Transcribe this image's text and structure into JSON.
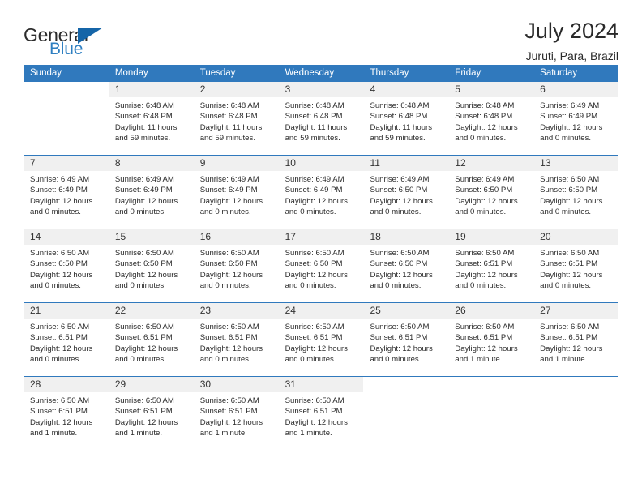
{
  "brand": {
    "name_part1": "General",
    "name_part2": "Blue",
    "triangle_icon": "triangle-icon",
    "accent_color": "#2e7fc1",
    "header_bar_color": "#3079bd"
  },
  "header": {
    "title": "July 2024",
    "subtitle": "Juruti, Para, Brazil"
  },
  "calendar": {
    "weekday_headers": [
      "Sunday",
      "Monday",
      "Tuesday",
      "Wednesday",
      "Thursday",
      "Friday",
      "Saturday"
    ],
    "weeks": [
      [
        {
          "day": "",
          "sunrise": "",
          "sunset": "",
          "daylight1": "",
          "daylight2": ""
        },
        {
          "day": "1",
          "sunrise": "Sunrise: 6:48 AM",
          "sunset": "Sunset: 6:48 PM",
          "daylight1": "Daylight: 11 hours",
          "daylight2": "and 59 minutes."
        },
        {
          "day": "2",
          "sunrise": "Sunrise: 6:48 AM",
          "sunset": "Sunset: 6:48 PM",
          "daylight1": "Daylight: 11 hours",
          "daylight2": "and 59 minutes."
        },
        {
          "day": "3",
          "sunrise": "Sunrise: 6:48 AM",
          "sunset": "Sunset: 6:48 PM",
          "daylight1": "Daylight: 11 hours",
          "daylight2": "and 59 minutes."
        },
        {
          "day": "4",
          "sunrise": "Sunrise: 6:48 AM",
          "sunset": "Sunset: 6:48 PM",
          "daylight1": "Daylight: 11 hours",
          "daylight2": "and 59 minutes."
        },
        {
          "day": "5",
          "sunrise": "Sunrise: 6:48 AM",
          "sunset": "Sunset: 6:48 PM",
          "daylight1": "Daylight: 12 hours",
          "daylight2": "and 0 minutes."
        },
        {
          "day": "6",
          "sunrise": "Sunrise: 6:49 AM",
          "sunset": "Sunset: 6:49 PM",
          "daylight1": "Daylight: 12 hours",
          "daylight2": "and 0 minutes."
        }
      ],
      [
        {
          "day": "7",
          "sunrise": "Sunrise: 6:49 AM",
          "sunset": "Sunset: 6:49 PM",
          "daylight1": "Daylight: 12 hours",
          "daylight2": "and 0 minutes."
        },
        {
          "day": "8",
          "sunrise": "Sunrise: 6:49 AM",
          "sunset": "Sunset: 6:49 PM",
          "daylight1": "Daylight: 12 hours",
          "daylight2": "and 0 minutes."
        },
        {
          "day": "9",
          "sunrise": "Sunrise: 6:49 AM",
          "sunset": "Sunset: 6:49 PM",
          "daylight1": "Daylight: 12 hours",
          "daylight2": "and 0 minutes."
        },
        {
          "day": "10",
          "sunrise": "Sunrise: 6:49 AM",
          "sunset": "Sunset: 6:49 PM",
          "daylight1": "Daylight: 12 hours",
          "daylight2": "and 0 minutes."
        },
        {
          "day": "11",
          "sunrise": "Sunrise: 6:49 AM",
          "sunset": "Sunset: 6:50 PM",
          "daylight1": "Daylight: 12 hours",
          "daylight2": "and 0 minutes."
        },
        {
          "day": "12",
          "sunrise": "Sunrise: 6:49 AM",
          "sunset": "Sunset: 6:50 PM",
          "daylight1": "Daylight: 12 hours",
          "daylight2": "and 0 minutes."
        },
        {
          "day": "13",
          "sunrise": "Sunrise: 6:50 AM",
          "sunset": "Sunset: 6:50 PM",
          "daylight1": "Daylight: 12 hours",
          "daylight2": "and 0 minutes."
        }
      ],
      [
        {
          "day": "14",
          "sunrise": "Sunrise: 6:50 AM",
          "sunset": "Sunset: 6:50 PM",
          "daylight1": "Daylight: 12 hours",
          "daylight2": "and 0 minutes."
        },
        {
          "day": "15",
          "sunrise": "Sunrise: 6:50 AM",
          "sunset": "Sunset: 6:50 PM",
          "daylight1": "Daylight: 12 hours",
          "daylight2": "and 0 minutes."
        },
        {
          "day": "16",
          "sunrise": "Sunrise: 6:50 AM",
          "sunset": "Sunset: 6:50 PM",
          "daylight1": "Daylight: 12 hours",
          "daylight2": "and 0 minutes."
        },
        {
          "day": "17",
          "sunrise": "Sunrise: 6:50 AM",
          "sunset": "Sunset: 6:50 PM",
          "daylight1": "Daylight: 12 hours",
          "daylight2": "and 0 minutes."
        },
        {
          "day": "18",
          "sunrise": "Sunrise: 6:50 AM",
          "sunset": "Sunset: 6:50 PM",
          "daylight1": "Daylight: 12 hours",
          "daylight2": "and 0 minutes."
        },
        {
          "day": "19",
          "sunrise": "Sunrise: 6:50 AM",
          "sunset": "Sunset: 6:51 PM",
          "daylight1": "Daylight: 12 hours",
          "daylight2": "and 0 minutes."
        },
        {
          "day": "20",
          "sunrise": "Sunrise: 6:50 AM",
          "sunset": "Sunset: 6:51 PM",
          "daylight1": "Daylight: 12 hours",
          "daylight2": "and 0 minutes."
        }
      ],
      [
        {
          "day": "21",
          "sunrise": "Sunrise: 6:50 AM",
          "sunset": "Sunset: 6:51 PM",
          "daylight1": "Daylight: 12 hours",
          "daylight2": "and 0 minutes."
        },
        {
          "day": "22",
          "sunrise": "Sunrise: 6:50 AM",
          "sunset": "Sunset: 6:51 PM",
          "daylight1": "Daylight: 12 hours",
          "daylight2": "and 0 minutes."
        },
        {
          "day": "23",
          "sunrise": "Sunrise: 6:50 AM",
          "sunset": "Sunset: 6:51 PM",
          "daylight1": "Daylight: 12 hours",
          "daylight2": "and 0 minutes."
        },
        {
          "day": "24",
          "sunrise": "Sunrise: 6:50 AM",
          "sunset": "Sunset: 6:51 PM",
          "daylight1": "Daylight: 12 hours",
          "daylight2": "and 0 minutes."
        },
        {
          "day": "25",
          "sunrise": "Sunrise: 6:50 AM",
          "sunset": "Sunset: 6:51 PM",
          "daylight1": "Daylight: 12 hours",
          "daylight2": "and 0 minutes."
        },
        {
          "day": "26",
          "sunrise": "Sunrise: 6:50 AM",
          "sunset": "Sunset: 6:51 PM",
          "daylight1": "Daylight: 12 hours",
          "daylight2": "and 1 minute."
        },
        {
          "day": "27",
          "sunrise": "Sunrise: 6:50 AM",
          "sunset": "Sunset: 6:51 PM",
          "daylight1": "Daylight: 12 hours",
          "daylight2": "and 1 minute."
        }
      ],
      [
        {
          "day": "28",
          "sunrise": "Sunrise: 6:50 AM",
          "sunset": "Sunset: 6:51 PM",
          "daylight1": "Daylight: 12 hours",
          "daylight2": "and 1 minute."
        },
        {
          "day": "29",
          "sunrise": "Sunrise: 6:50 AM",
          "sunset": "Sunset: 6:51 PM",
          "daylight1": "Daylight: 12 hours",
          "daylight2": "and 1 minute."
        },
        {
          "day": "30",
          "sunrise": "Sunrise: 6:50 AM",
          "sunset": "Sunset: 6:51 PM",
          "daylight1": "Daylight: 12 hours",
          "daylight2": "and 1 minute."
        },
        {
          "day": "31",
          "sunrise": "Sunrise: 6:50 AM",
          "sunset": "Sunset: 6:51 PM",
          "daylight1": "Daylight: 12 hours",
          "daylight2": "and 1 minute."
        },
        {
          "day": "",
          "sunrise": "",
          "sunset": "",
          "daylight1": "",
          "daylight2": ""
        },
        {
          "day": "",
          "sunrise": "",
          "sunset": "",
          "daylight1": "",
          "daylight2": ""
        },
        {
          "day": "",
          "sunrise": "",
          "sunset": "",
          "daylight1": "",
          "daylight2": ""
        }
      ]
    ]
  }
}
